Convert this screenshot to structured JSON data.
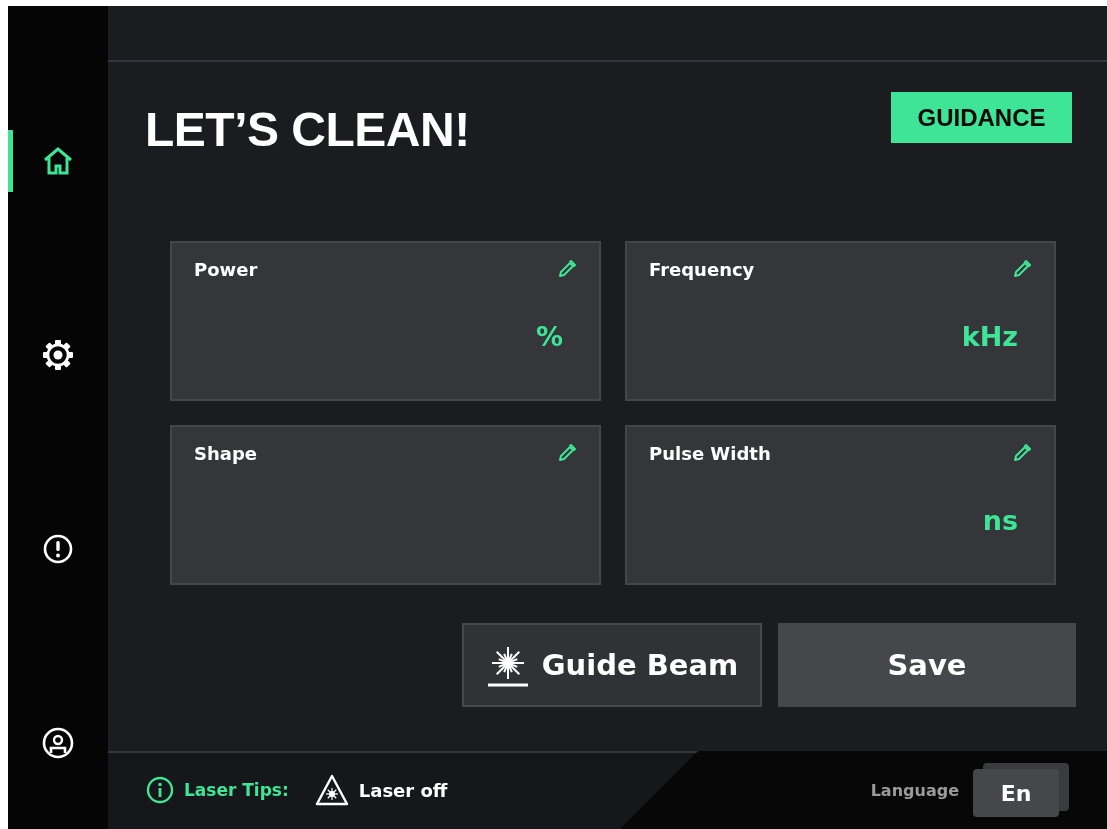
{
  "sidebar": {
    "items": [
      {
        "kind": "home",
        "selected": true
      },
      {
        "kind": "settings",
        "selected": false
      },
      {
        "kind": "alert",
        "selected": false
      },
      {
        "kind": "account",
        "selected": false
      }
    ]
  },
  "header": {
    "title": "LET’S CLEAN!",
    "guidance_button": "GUIDANCE"
  },
  "parameters": [
    {
      "label": "Power",
      "unit": "%"
    },
    {
      "label": "Frequency",
      "unit": "kHz"
    },
    {
      "label": "Shape"
    },
    {
      "label": "Pulse Width",
      "unit": "ns"
    }
  ],
  "actions": {
    "guide_beam": "Guide Beam",
    "save": "Save"
  },
  "footer": {
    "tips_label": "Laser Tips:",
    "laser_status": "Laser off",
    "language_label": "Language",
    "language": "En"
  }
}
